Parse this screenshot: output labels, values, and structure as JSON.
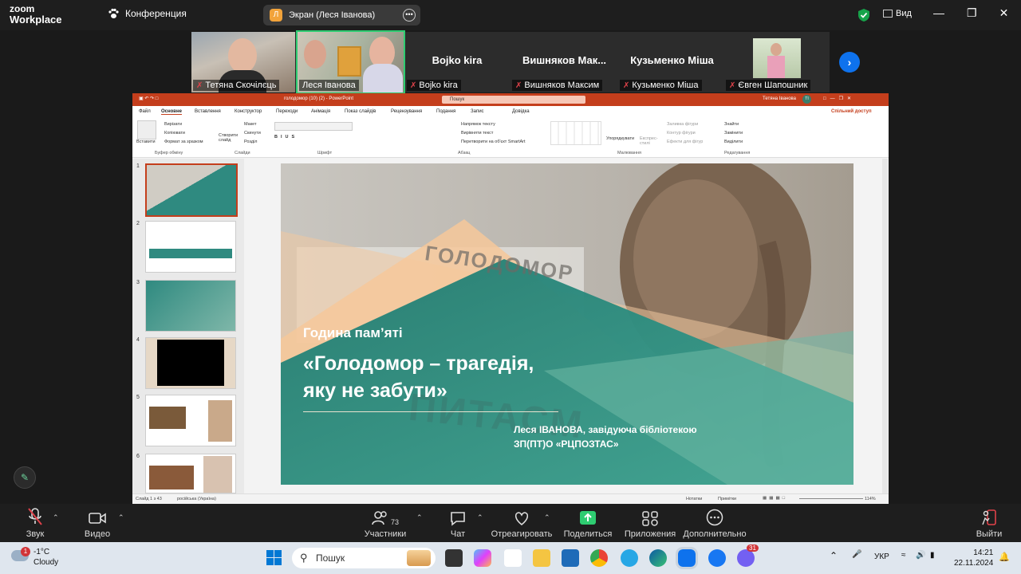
{
  "zoom": {
    "logo_line1": "zoom",
    "logo_line2": "Workplace",
    "meeting_label": "Конференция",
    "share_badge_letter": "Л",
    "share_label": "Экран (Леся Іванова)",
    "view_label": "Вид",
    "accent": "#0e72ed",
    "shield_color": "#17a34a"
  },
  "participants": [
    {
      "name": "Тетяна Скочілєць",
      "muted": true,
      "video": true
    },
    {
      "name": "Леся Іванова",
      "muted": false,
      "video": true,
      "active": true
    },
    {
      "name": "Bojko kira",
      "muted": true,
      "video": false,
      "big": "Bojko kira"
    },
    {
      "name": "Вишняков Максим",
      "muted": true,
      "video": false,
      "big": "Вишняков Мак..."
    },
    {
      "name": "Кузьменко Міша",
      "muted": true,
      "video": false,
      "big": "Кузьменко Міша"
    },
    {
      "name": "Євген Шапошник",
      "muted": true,
      "video": true
    }
  ],
  "ppt": {
    "title": "голодомор (10) (2)  -  PowerPoint",
    "search": "Пошук",
    "user": "Тетяна Іванова",
    "user_initials": "ТІ",
    "share_btn": "Спільний доступ",
    "tabs": [
      "Файл",
      "Основне",
      "Вставлення",
      "Конструктор",
      "Переходи",
      "Анімація",
      "Показ слайдів",
      "Рецензування",
      "Подання",
      "Запис",
      "Довідка"
    ],
    "ribbon": {
      "paste": "Вставити",
      "cut": "Вирізати",
      "copy": "Копіювати",
      "format_painter": "Формат за зразком",
      "clipboard_group": "Буфер обміну",
      "new_slide": "Створити слайд",
      "layout": "Макет",
      "reset": "Скинути",
      "section": "Розділ",
      "slides_group": "Слайди",
      "font_group": "Шрифт",
      "text_dir": "Напрямок тексту",
      "align_text": "Вирівняти текст",
      "smartart": "Перетворити на об'єкт SmartArt",
      "paragraph_group": "Абзац",
      "arrange": "Упорядкувати",
      "quick_styles": "Експрес-стилі",
      "shape_fill": "Заливка фігури",
      "shape_outline": "Контур фігури",
      "shape_effects": "Ефекти для фігур",
      "drawing_group": "Малювання",
      "find": "Знайти",
      "replace": "Замінити",
      "select": "Виділити",
      "editing_group": "Редагування"
    },
    "slide_numbers": [
      "1",
      "2",
      "3",
      "4",
      "5",
      "6"
    ],
    "slide": {
      "subtitle": "Година пам’яті",
      "title_line1": "«Голодомор – трагедія,",
      "title_line2": "яку не забути»",
      "author_line1": "Леся ІВАНОВА, завідуюча бібліотекою",
      "author_line2": "ЗП(ПТ)О «РЦПОЗТАС»",
      "bg_text1": "ГОЛОДОМОР",
      "bg_text2": "ПИТАСМ"
    },
    "status": {
      "slide_count": "Слайд 1 з 43",
      "language": "російська (Україна)",
      "notes": "Нотатки",
      "comments": "Примітки",
      "zoom": "114%"
    }
  },
  "toolbar": {
    "audio": "Звук",
    "video": "Видео",
    "participants": "Участники",
    "participants_count": "73",
    "chat": "Чат",
    "react": "Отреагировать",
    "share": "Поделиться",
    "apps": "Приложения",
    "more": "Дополнительно",
    "leave": "Выйти"
  },
  "taskbar": {
    "temp": "-1°C",
    "weather": "Cloudy",
    "weather_badge": "1",
    "search": "Пошук",
    "viber_badge": "31",
    "lang": "УКР",
    "time": "14:21",
    "date": "22.11.2024"
  }
}
